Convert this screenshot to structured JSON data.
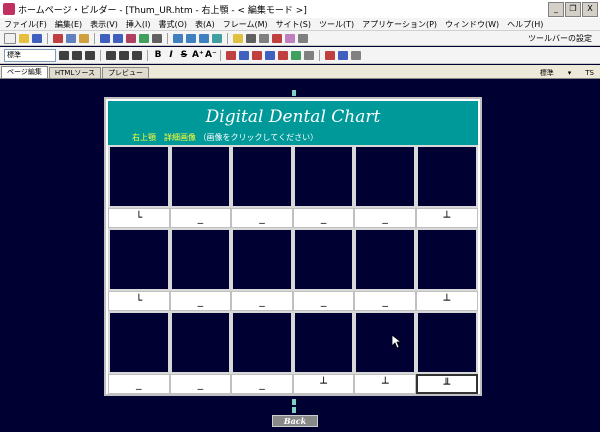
{
  "window": {
    "title": "ホームページ・ビルダー - [Thum_UR.htm - 右上顎 - < 編集モード >]",
    "minimize": "_",
    "restore": "❐",
    "close": "X"
  },
  "menu": {
    "items": [
      "ファイル(F)",
      "編集(E)",
      "表示(V)",
      "挿入(I)",
      "書式(O)",
      "表(A)",
      "フレーム(M)",
      "サイト(S)",
      "ツール(T)",
      "アプリケーション(P)",
      "ウィンドウ(W)",
      "ヘルプ(H)"
    ]
  },
  "toolbar": {
    "right_label": "ツールバーの設定",
    "font_value": "標準",
    "bold": "B",
    "italic": "I",
    "strike": "S",
    "font_size_up": "A⁺",
    "font_size_down": "A⁻"
  },
  "tabs": {
    "items": [
      "ページ編集",
      "HTMLソース",
      "プレビュー"
    ],
    "right_items": [
      "標準",
      "▾",
      "TS"
    ]
  },
  "chart": {
    "title": "Digital Dental Chart",
    "subtitle_highlight": "右上顎　詳細画像",
    "subtitle_note": "（画像をクリックしてください）",
    "rows": [
      [
        "└",
        "_",
        "_",
        "_",
        "_",
        "┴"
      ],
      [
        "└",
        "_",
        "_",
        "_",
        "_",
        "┴"
      ],
      [
        "_",
        "_",
        "_",
        "┴",
        "┴",
        "╨"
      ]
    ],
    "back_label": "Back"
  },
  "colors": {
    "background": "#000033",
    "header": "#009999",
    "highlight_text": "#ffff33"
  }
}
